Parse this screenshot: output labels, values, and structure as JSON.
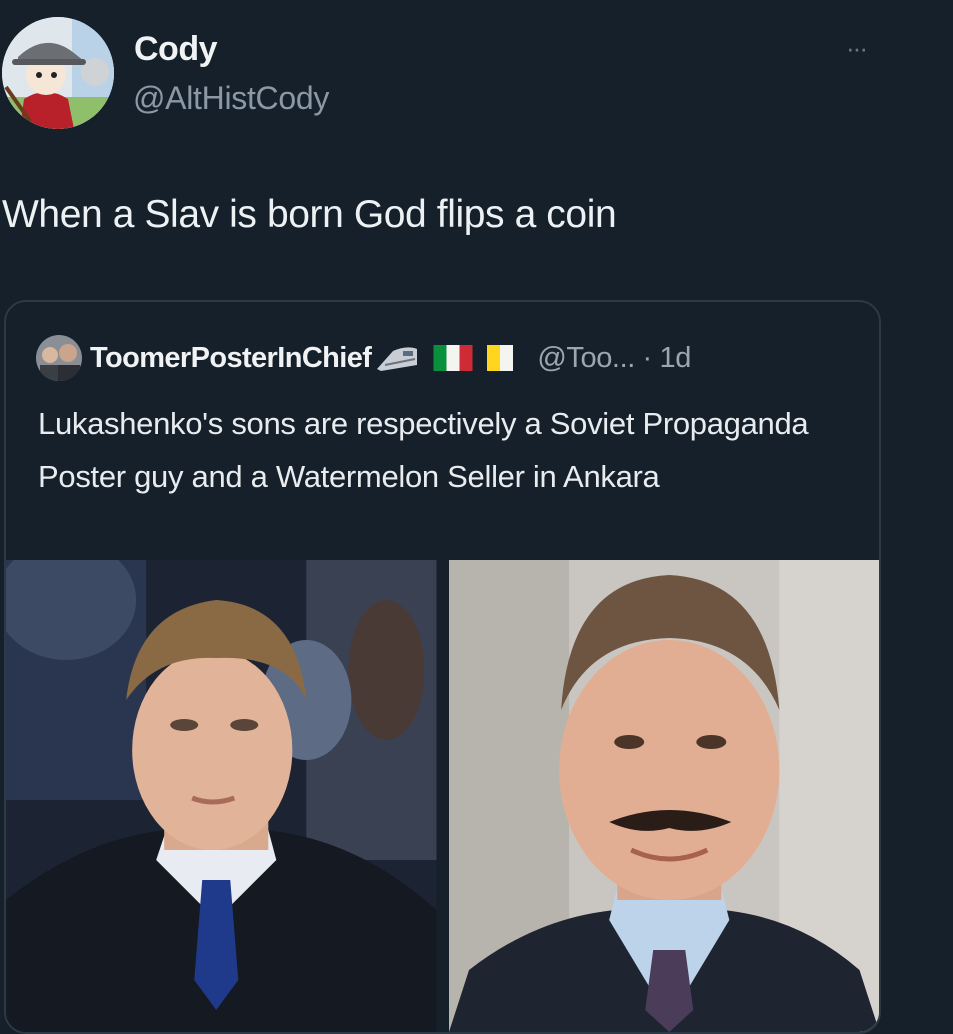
{
  "tweet": {
    "author_name": "Cody",
    "author_handle": "@AltHistCody",
    "more_label": "···",
    "text": "When a Slav is born God flips a coin"
  },
  "quote": {
    "author_name": "ToomerPosterInChief",
    "handle_time": "@Too... · 1d",
    "text": "Lukashenko's sons are respectively a Soviet Propaganda Poster guy and a Watermelon Seller in Ankara",
    "badges": [
      "train-icon",
      "italy-flag-icon",
      "vatican-flag-icon"
    ]
  },
  "media": {
    "count": 2,
    "items": [
      "young-man-photo",
      "mustached-man-photo"
    ]
  },
  "colors": {
    "background": "#15202b",
    "text_primary": "#e7e9ea",
    "text_secondary": "#8b98a5",
    "border": "#2c3a47"
  }
}
